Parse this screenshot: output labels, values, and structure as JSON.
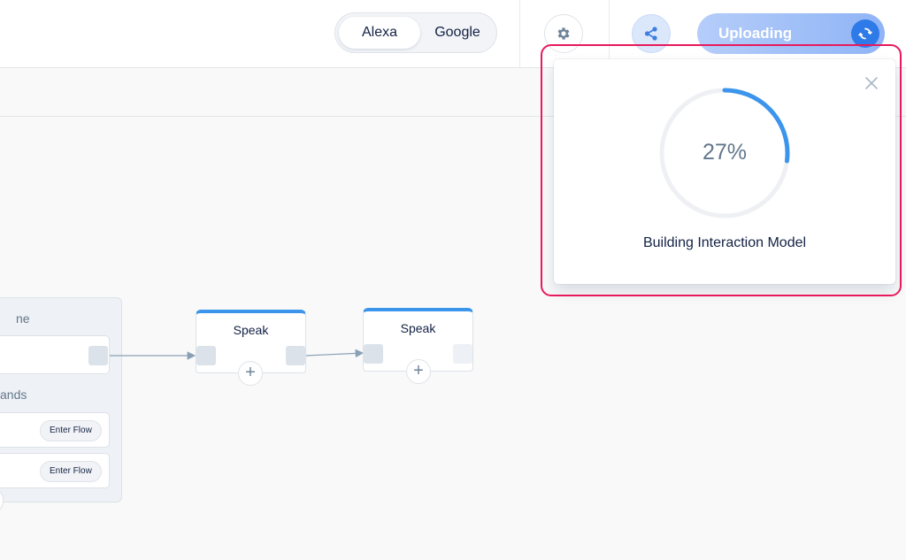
{
  "header": {
    "platform_toggle": {
      "options": [
        "Alexa",
        "Google"
      ],
      "selected": "Alexa"
    },
    "upload_button": {
      "label": "Uploading"
    },
    "icons": {
      "settings": "gear-icon",
      "share": "share-icon",
      "upload_status": "spinner-icon"
    }
  },
  "canvas": {
    "block": {
      "title": "ne",
      "section_label": "ands",
      "commands": [
        {
          "action_label": "Enter Flow"
        },
        {
          "action_label": "Enter Flow"
        }
      ]
    },
    "nodes": [
      {
        "title": "Speak"
      },
      {
        "title": "Speak"
      }
    ],
    "add_step_symbol": "+"
  },
  "upload_popup": {
    "progress_value": 0.27,
    "progress_label": "27%",
    "status": "Building Interaction Model",
    "close_symbol": "close-icon"
  },
  "colors": {
    "accent": "#3c95ec",
    "progress_track": "#eef0f3",
    "highlight": "#e8195d",
    "upload_button": "#8fb4f6"
  }
}
